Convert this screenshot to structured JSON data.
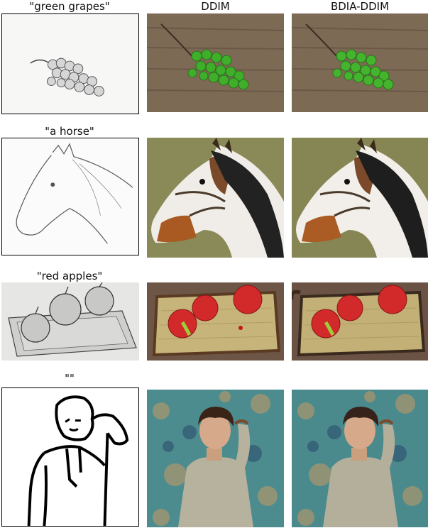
{
  "columns": {
    "ddim": "DDIM",
    "bdia": "BDIA-DDIM"
  },
  "rows": [
    {
      "prompt": "\"green grapes\""
    },
    {
      "prompt": "\"a horse\""
    },
    {
      "prompt": "\"red apples\""
    },
    {
      "prompt": "\"\""
    }
  ],
  "colors": {
    "wood": "#7d6a55",
    "grape": "#3fae2a",
    "apple": "#d22a2a",
    "horse_bg": "#8a8a58",
    "wallpaper": "#4c8c8e",
    "shirt": "#b7b29e"
  }
}
